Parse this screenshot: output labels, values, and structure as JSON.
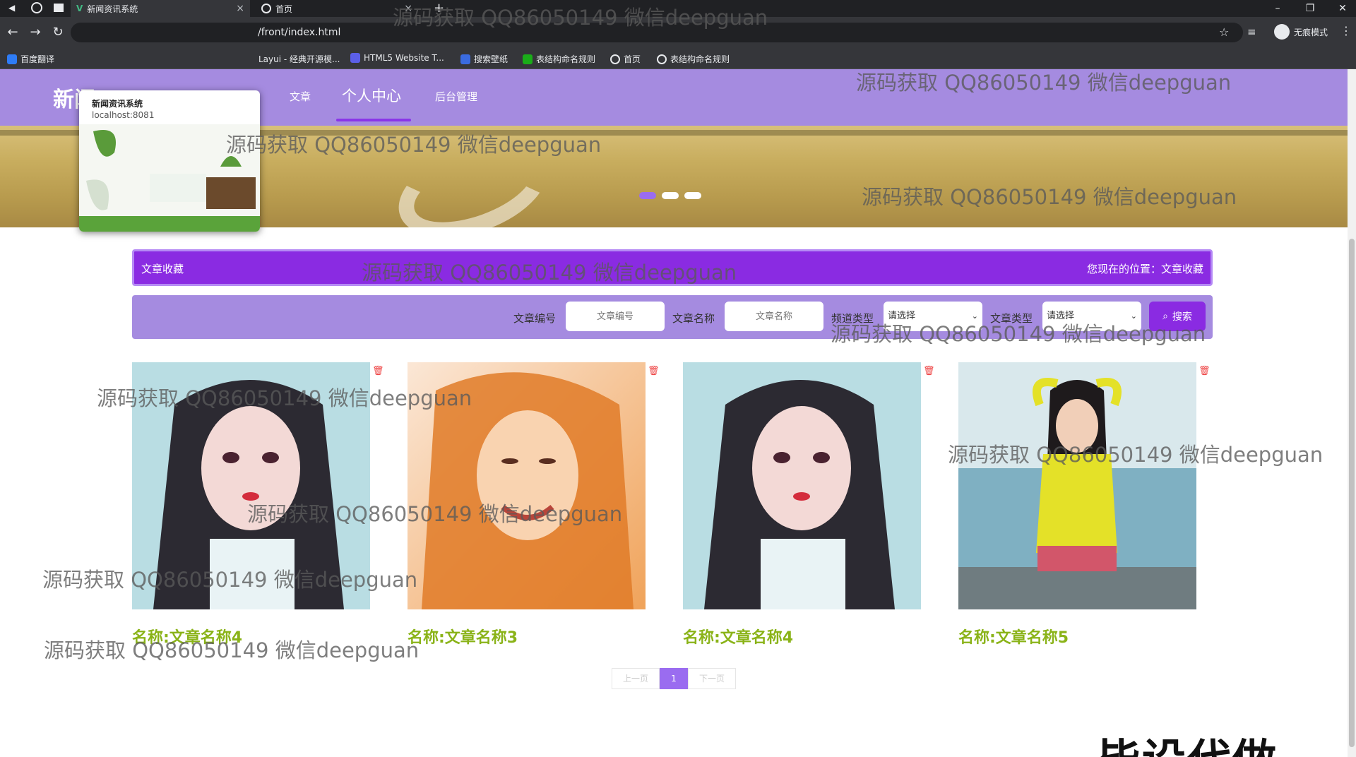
{
  "browser": {
    "tabs": [
      {
        "label": "新闻资讯系统",
        "active": true
      },
      {
        "label": "首页",
        "active": false
      }
    ],
    "url": "/front/index.html",
    "profile_label": "无痕模式",
    "bookmarks": [
      "百度翻译",
      "Layui - 经典开源模...",
      "HTML5 Website T...",
      "搜索壁纸",
      "表结构命名规则",
      "首页",
      "表结构命名规则"
    ],
    "hover_card": {
      "title": "新闻资讯系统",
      "host": "localhost:8081"
    }
  },
  "nav": {
    "brand": "新闻",
    "links": [
      "文章",
      "个人中心",
      "后台管理"
    ],
    "active_index": 1
  },
  "banner": {
    "slide_count": 3,
    "active_slide": 0
  },
  "title_bar": {
    "left": "文章收藏",
    "right": "您现在的位置：文章收藏"
  },
  "search": {
    "fields": [
      {
        "label": "文章编号",
        "placeholder": "文章编号"
      },
      {
        "label": "文章名称",
        "placeholder": "文章名称"
      }
    ],
    "selects": [
      {
        "label": "频道类型",
        "value": "请选择"
      },
      {
        "label": "文章类型",
        "value": "请选择"
      }
    ],
    "button_label": "搜索"
  },
  "cards": [
    {
      "name": "名称:文章名称4"
    },
    {
      "name": "名称:文章名称3"
    },
    {
      "name": "名称:文章名称4"
    },
    {
      "name": "名称:文章名称5"
    }
  ],
  "pager": {
    "prev": "上一页",
    "current": "1",
    "next": "下一页"
  },
  "watermark": "源码获取 QQ86050149 微信deepguan",
  "overlay_text": "毕设代做",
  "colors": {
    "nav": "#a58be0",
    "accent": "#8a2be2",
    "name_text": "#8ab318"
  }
}
